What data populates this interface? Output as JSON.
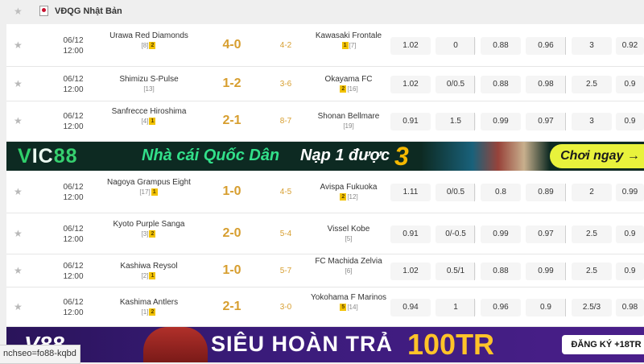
{
  "league": {
    "name": "VĐQG Nhật Bản"
  },
  "matches": [
    {
      "date": "06/12",
      "time": "12:00",
      "home": "Urawa Red Diamonds",
      "home_rank": "[8]",
      "home_badge": "2",
      "score": "4-0",
      "ht": "4-2",
      "away": "Kawasaki Frontale",
      "away_rank": "[7]",
      "away_badge": "1",
      "odds": [
        "1.02",
        "0",
        "0.88",
        "0.96",
        "3",
        "0.92"
      ]
    },
    {
      "date": "06/12",
      "time": "12:00",
      "home": "Shimizu S-Pulse",
      "home_rank": "[13]",
      "home_badge": "",
      "score": "1-2",
      "ht": "3-6",
      "away": "Okayama FC",
      "away_rank": "[16]",
      "away_badge": "2",
      "odds": [
        "1.02",
        "0/0.5",
        "0.88",
        "0.98",
        "2.5",
        "0.9"
      ]
    },
    {
      "date": "06/12",
      "time": "12:00",
      "home": "Sanfrecce Hiroshima",
      "home_rank": "[4]",
      "home_badge": "1",
      "score": "2-1",
      "ht": "8-7",
      "away": "Shonan Bellmare",
      "away_rank": "[19]",
      "away_badge": "",
      "odds": [
        "0.91",
        "1.5",
        "0.99",
        "0.97",
        "3",
        "0.9"
      ]
    },
    {
      "date": "06/12",
      "time": "12:00",
      "home": "Nagoya Grampus Eight",
      "home_rank": "[17]",
      "home_badge": "1",
      "score": "1-0",
      "ht": "4-5",
      "away": "Avispa Fukuoka",
      "away_rank": "[12]",
      "away_badge": "2",
      "odds": [
        "1.11",
        "0/0.5",
        "0.8",
        "0.89",
        "2",
        "0.99"
      ]
    },
    {
      "date": "06/12",
      "time": "12:00",
      "home": "Kyoto Purple Sanga",
      "home_rank": "[3]",
      "home_badge": "2",
      "score": "2-0",
      "ht": "5-4",
      "away": "Vissel Kobe",
      "away_rank": "[5]",
      "away_badge": "",
      "odds": [
        "0.91",
        "0/-0.5",
        "0.99",
        "0.97",
        "2.5",
        "0.9"
      ]
    },
    {
      "date": "06/12",
      "time": "12:00",
      "home": "Kashiwa Reysol",
      "home_rank": "[2]",
      "home_badge": "1",
      "score": "1-0",
      "ht": "5-7",
      "away": "FC Machida Zelvia",
      "away_rank": "[6]",
      "away_badge": "",
      "odds": [
        "1.02",
        "0.5/1",
        "0.88",
        "0.99",
        "2.5",
        "0.9"
      ]
    },
    {
      "date": "06/12",
      "time": "12:00",
      "home": "Kashima Antlers",
      "home_rank": "[1]",
      "home_badge": "2",
      "score": "2-1",
      "ht": "3-0",
      "away": "Yokohama F Marinos",
      "away_rank": "[14]",
      "away_badge": "5",
      "odds": [
        "0.94",
        "1",
        "0.96",
        "0.9",
        "2.5/3",
        "0.98"
      ]
    }
  ],
  "ad_vic88": {
    "logo_v": "V",
    "logo_ic": "IC",
    "logo_num": "88",
    "tagline": "Nhà cái Quốc Dân",
    "offer": "Nạp 1 được",
    "offer_num": "3",
    "cta": "Chơi ngay →"
  },
  "ad_v88": {
    "logo": "V88",
    "headline": "SIÊU HOÀN TRẢ",
    "amount": "100TR",
    "cta": "ĐĂNG KÝ +18TR"
  },
  "status_url": "nchseo=fo88-kqbd",
  "colors": {
    "score": "#d79e2f",
    "badge": "#f2c200",
    "vic_green": "#32e08a",
    "vic_gold": "#f5b800",
    "v88_purple": "#3a1b7a",
    "v88_gold": "#ffc329"
  },
  "icons": {
    "favorite": "star-icon",
    "league_flag": "japan-flag-icon"
  }
}
